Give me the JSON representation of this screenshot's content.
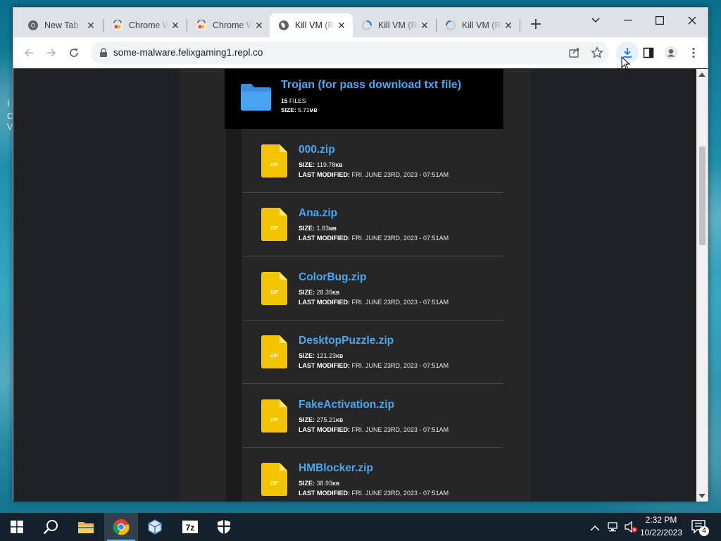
{
  "desktop": {
    "icon_fragments": [
      "I",
      "C",
      "V"
    ]
  },
  "browser": {
    "tabs": [
      {
        "title": "New Tab",
        "icon": "chrome-icon",
        "active": false
      },
      {
        "title": "Chrome Web Store",
        "icon": "chrome-web-store-icon",
        "active": false
      },
      {
        "title": "Chrome Web Store",
        "icon": "chrome-web-store-icon",
        "active": false
      },
      {
        "title": "Kill VM (Replit)",
        "icon": "globe-icon",
        "active": true
      },
      {
        "title": "Kill VM (Replit)",
        "icon": "loading-icon",
        "active": false
      },
      {
        "title": "Kill VM (Replit)",
        "icon": "loading-icon",
        "active": false
      }
    ],
    "url": "some-malware.felixgaming1.repl.co"
  },
  "folder": {
    "name": "Trojan (for pass download txt file)",
    "file_count_value": "15",
    "file_count_label": "FILES",
    "size_label": "SIZE:",
    "size_value": "5.71",
    "size_unit": "MB"
  },
  "files": [
    {
      "name": "000.zip",
      "size_value": "119.78",
      "size_unit": "KB",
      "modified": "FRI. JUNE 23RD, 2023 - 07:51AM"
    },
    {
      "name": "Ana.zip",
      "size_value": "1.83",
      "size_unit": "MB",
      "modified": "FRI. JUNE 23RD, 2023 - 07:51AM"
    },
    {
      "name": "ColorBug.zip",
      "size_value": "28.39",
      "size_unit": "KB",
      "modified": "FRI. JUNE 23RD, 2023 - 07:51AM"
    },
    {
      "name": "DesktopPuzzle.zip",
      "size_value": "121.23",
      "size_unit": "KB",
      "modified": "FRI. JUNE 23RD, 2023 - 07:51AM"
    },
    {
      "name": "FakeActivation.zip",
      "size_value": "275.21",
      "size_unit": "KB",
      "modified": "FRI. JUNE 23RD, 2023 - 07:51AM"
    },
    {
      "name": "HMBlocker.zip",
      "size_value": "38.93",
      "size_unit": "KB",
      "modified": "FRI. JUNE 23RD, 2023 - 07:51AM"
    }
  ],
  "labels": {
    "size": "SIZE:",
    "last_modified": "LAST MODIFIED:",
    "zip_badge": "ZIP"
  },
  "taskbar": {
    "time": "2:32 PM",
    "date": "10/22/2023",
    "notification_count": "4"
  },
  "colors": {
    "link_blue": "#4aa8f0",
    "zip_yellow": "#f5c400",
    "folder_blue": "#3d8fe0",
    "page_bg": "#202124"
  }
}
